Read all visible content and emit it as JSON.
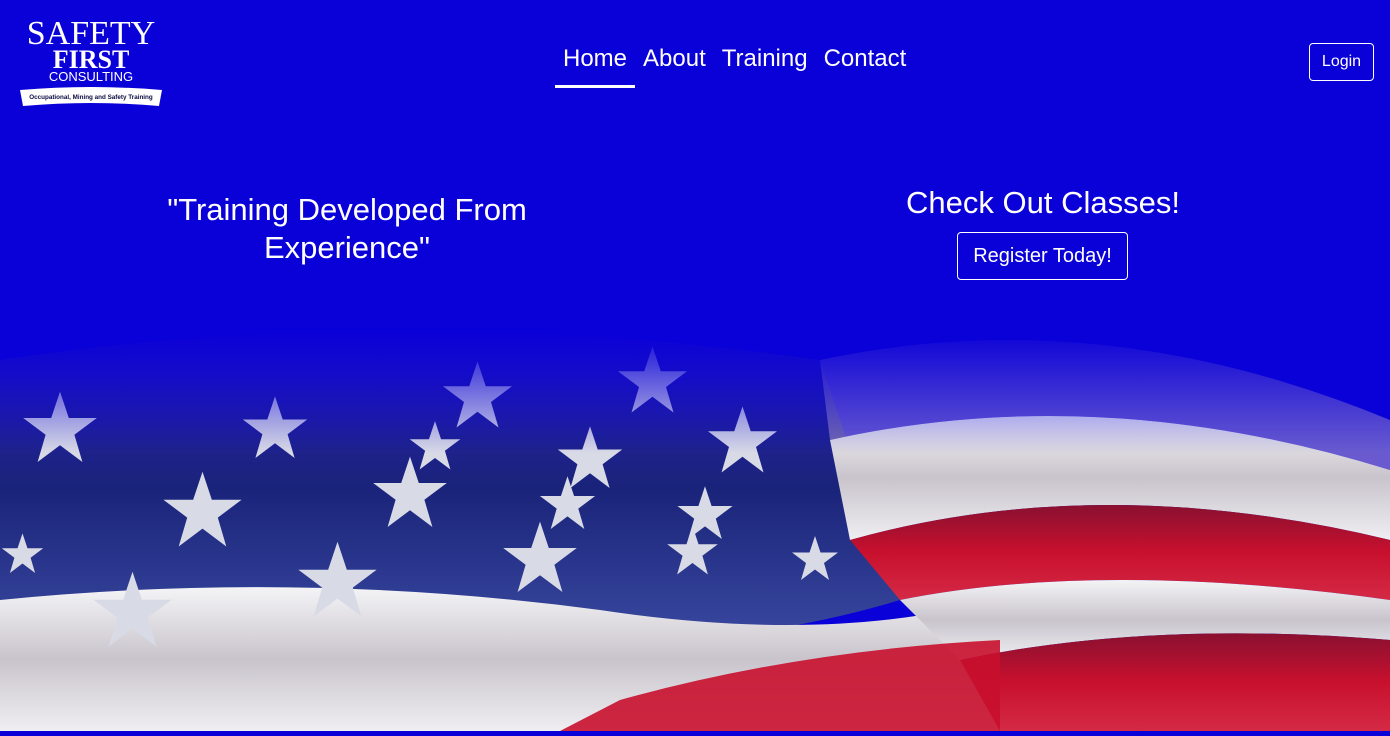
{
  "brand": {
    "logo_line1": "SAFETY",
    "logo_line2": "FIRST",
    "logo_line3": "CONSULTING",
    "logo_ribbon": "Occupational, Mining and Safety Training"
  },
  "nav": {
    "items": [
      {
        "label": "Home",
        "active": true
      },
      {
        "label": "About",
        "active": false
      },
      {
        "label": "Training",
        "active": false
      },
      {
        "label": "Contact",
        "active": false
      }
    ],
    "login_label": "Login"
  },
  "hero": {
    "tagline": "\"Training Developed From Experience\"",
    "cta_title": "Check Out Classes!",
    "cta_button": "Register Today!",
    "background_image": "waving-american-flag"
  },
  "colors": {
    "background": "#0a00d8",
    "text": "#ffffff",
    "flag_red": "#c8102e",
    "flag_blue": "#1c2a7a"
  }
}
